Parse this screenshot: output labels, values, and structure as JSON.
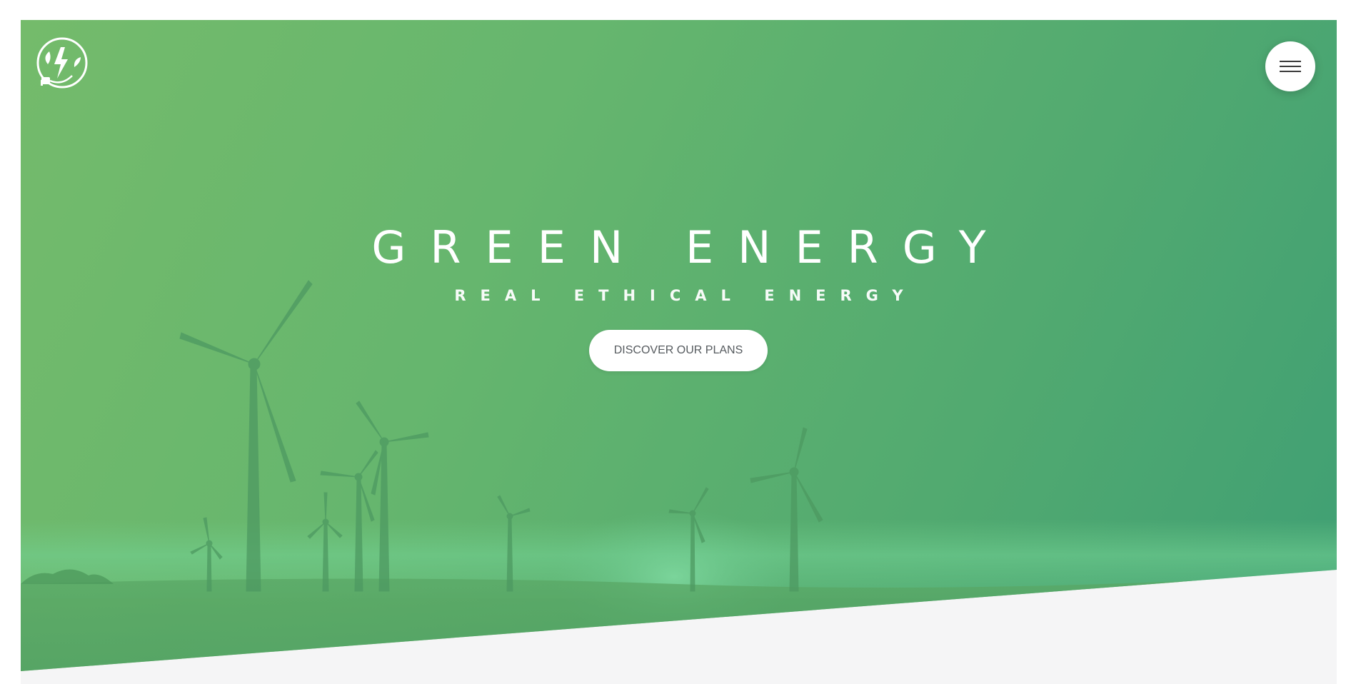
{
  "hero": {
    "title": "GREEN ENERGY",
    "subtitle": "REAL ETHICAL ENERGY",
    "cta_label": "DISCOVER OUR PLANS"
  },
  "header": {
    "logo_icon": "plug-leaf-lightning-icon",
    "menu_icon": "hamburger-menu-icon"
  },
  "colors": {
    "hero_green_light": "#74bb6b",
    "hero_green_dark": "#3f9f74",
    "page_background": "#f5f5f6",
    "button_background": "#ffffff",
    "button_text": "#555a5e"
  }
}
